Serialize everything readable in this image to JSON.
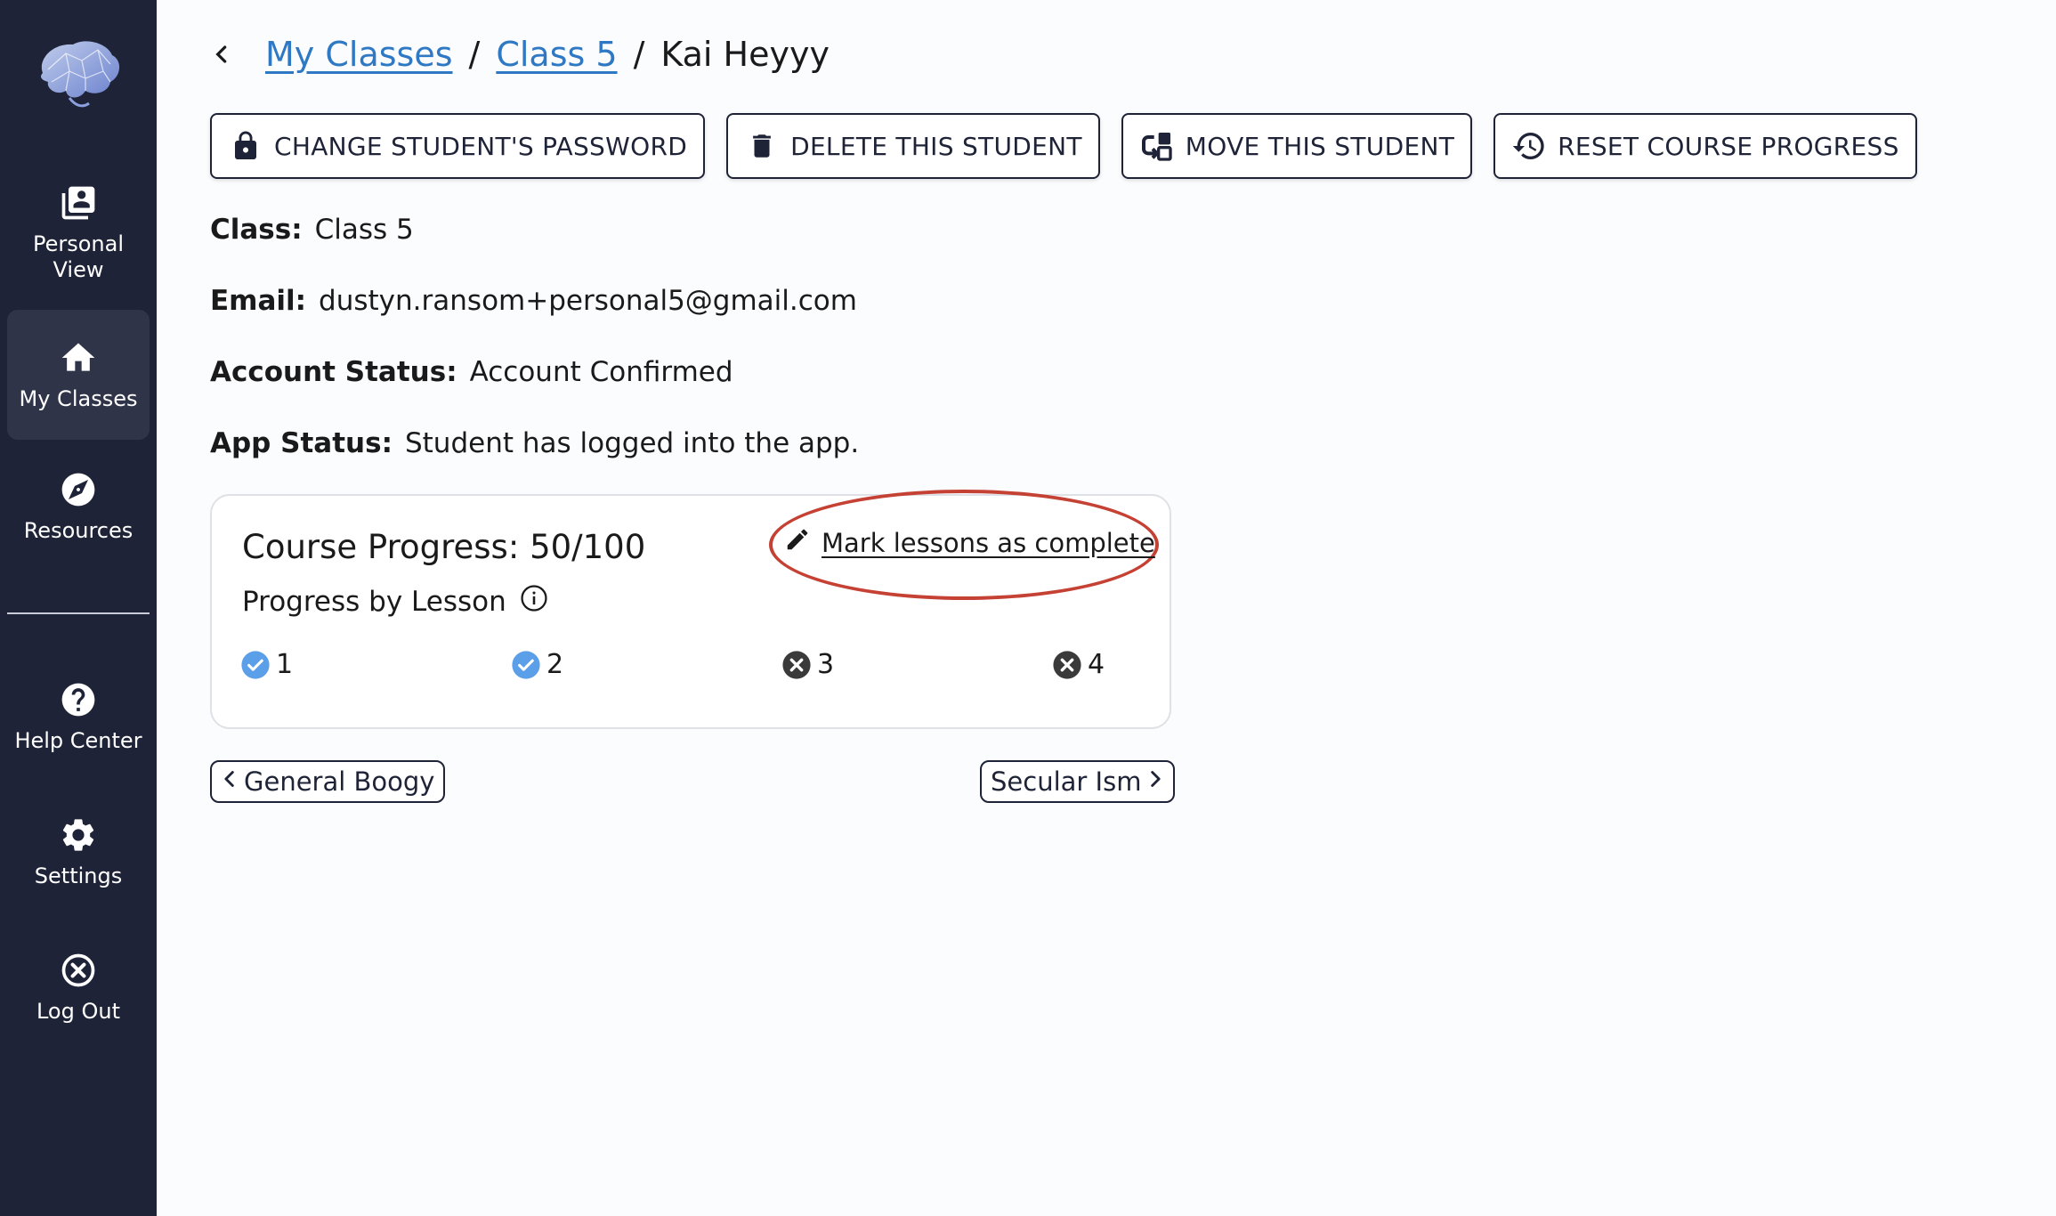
{
  "sidebar": {
    "items": [
      {
        "label_line1": "Personal",
        "label_line2": "View",
        "icon": "person-book-icon"
      },
      {
        "label": "My Classes",
        "icon": "home-icon",
        "active": true
      },
      {
        "label": "Resources",
        "icon": "compass-icon"
      },
      {
        "label": "Help Center",
        "icon": "help-icon"
      },
      {
        "label": "Settings",
        "icon": "gear-icon"
      },
      {
        "label": "Log Out",
        "icon": "close-circle-icon"
      }
    ]
  },
  "breadcrumb": {
    "items": [
      "My Classes",
      "Class 5"
    ],
    "separator": "/",
    "current": "Kai Heyyy"
  },
  "actions": {
    "change_password": "CHANGE STUDENT'S PASSWORD",
    "delete_student": "DELETE THIS STUDENT",
    "move_student": "MOVE THIS STUDENT",
    "reset_progress": "RESET COURSE PROGRESS"
  },
  "info": {
    "class_label": "Class:",
    "class_value": "Class 5",
    "email_label": "Email:",
    "email_value": "dustyn.ransom+personal5@gmail.com",
    "account_label": "Account Status:",
    "account_value": "Account Confirmed",
    "app_label": "App Status:",
    "app_value": "Student has logged into the app."
  },
  "progress": {
    "title": "Course Progress: 50/100",
    "subtitle": "Progress by Lesson",
    "mark_link": "Mark lessons as complete",
    "lessons": [
      {
        "number": "1",
        "complete": true
      },
      {
        "number": "2",
        "complete": true
      },
      {
        "number": "3",
        "complete": false
      },
      {
        "number": "4",
        "complete": false
      }
    ]
  },
  "pager": {
    "prev": "General Boogy",
    "next": "Secular Ism"
  },
  "colors": {
    "sidebar_bg": "#1f2337",
    "link": "#2f78c4",
    "complete": "#5a9fe8",
    "incomplete": "#3a3a3a",
    "annotation": "#c44133"
  }
}
